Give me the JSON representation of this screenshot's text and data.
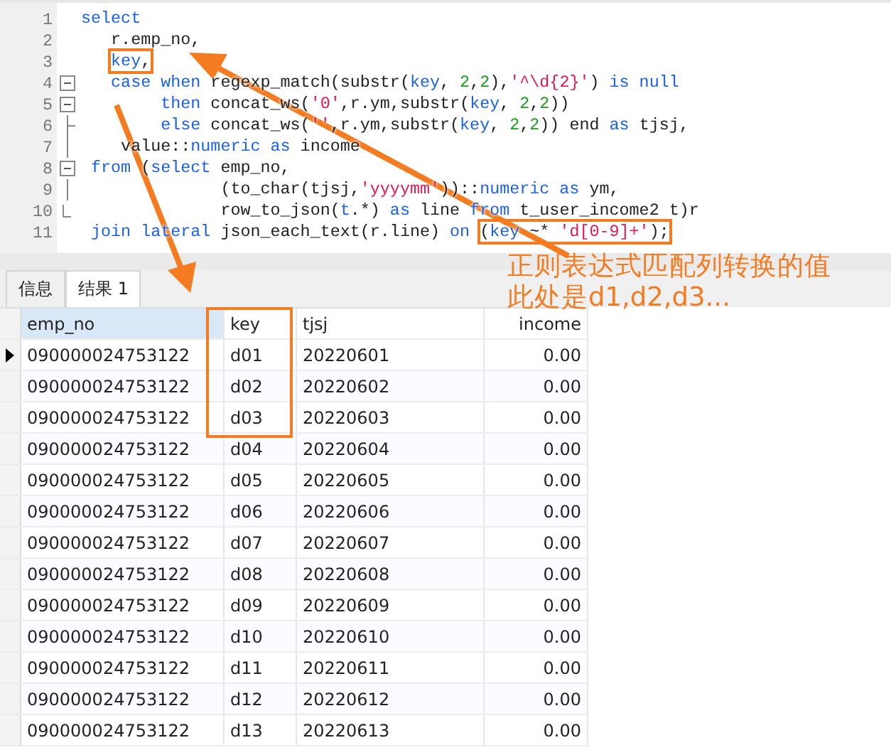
{
  "editor": {
    "lines": [
      {
        "number": "1",
        "kind": "plain",
        "tokens": [
          {
            "kind": "kw",
            "text": "select"
          }
        ]
      },
      {
        "number": "2",
        "kind": "plain",
        "tokens": [
          {
            "kind": "plain",
            "text": "   r.emp_no,"
          }
        ]
      },
      {
        "number": "3",
        "kind": "plain",
        "tokens": [
          {
            "kind": "kw",
            "text": "   key",
            "boxed": true
          },
          {
            "kind": "plain",
            "text": ",",
            "boxed": true
          }
        ]
      },
      {
        "number": "4",
        "kind": "fold-start",
        "tokens": [
          {
            "kind": "kw",
            "text": "   case when"
          },
          {
            "kind": "plain",
            "text": " regexp_match(substr("
          },
          {
            "kind": "kw",
            "text": "key"
          },
          {
            "kind": "plain",
            "text": ", "
          },
          {
            "kind": "num",
            "text": "2"
          },
          {
            "kind": "plain",
            "text": ","
          },
          {
            "kind": "num",
            "text": "2"
          },
          {
            "kind": "plain",
            "text": "),"
          },
          {
            "kind": "str",
            "text": "'^\\d{2}'"
          },
          {
            "kind": "plain",
            "text": ") "
          },
          {
            "kind": "kw",
            "text": "is null"
          }
        ]
      },
      {
        "number": "5",
        "kind": "fold-start",
        "tokens": [
          {
            "kind": "kw",
            "text": "        then"
          },
          {
            "kind": "plain",
            "text": " concat_ws("
          },
          {
            "kind": "str",
            "text": "'0'"
          },
          {
            "kind": "plain",
            "text": ",r.ym,substr("
          },
          {
            "kind": "kw",
            "text": "key"
          },
          {
            "kind": "plain",
            "text": ", "
          },
          {
            "kind": "num",
            "text": "2"
          },
          {
            "kind": "plain",
            "text": ","
          },
          {
            "kind": "num",
            "text": "2"
          },
          {
            "kind": "plain",
            "text": "))"
          }
        ]
      },
      {
        "number": "6",
        "kind": "fold-branch",
        "tokens": [
          {
            "kind": "kw",
            "text": "        else"
          },
          {
            "kind": "plain",
            "text": " concat_ws("
          },
          {
            "kind": "str",
            "text": "''"
          },
          {
            "kind": "plain",
            "text": ",r.ym,substr("
          },
          {
            "kind": "kw",
            "text": "key"
          },
          {
            "kind": "plain",
            "text": ", "
          },
          {
            "kind": "num",
            "text": "2"
          },
          {
            "kind": "plain",
            "text": ","
          },
          {
            "kind": "num",
            "text": "2"
          },
          {
            "kind": "plain",
            "text": ")) end"
          },
          {
            "kind": "kw",
            "text": " as"
          },
          {
            "kind": "plain",
            "text": " tjsj,"
          }
        ]
      },
      {
        "number": "7",
        "kind": "fold-line",
        "tokens": [
          {
            "kind": "plain",
            "text": "    value::"
          },
          {
            "kind": "kw",
            "text": "numeric as"
          },
          {
            "kind": "plain",
            "text": " income"
          }
        ]
      },
      {
        "number": "8",
        "kind": "fold-start",
        "tokens": [
          {
            "kind": "kw",
            "text": " from"
          },
          {
            "kind": "plain",
            "text": " ("
          },
          {
            "kind": "kw",
            "text": "select"
          },
          {
            "kind": "plain",
            "text": " emp_no,"
          }
        ]
      },
      {
        "number": "9",
        "kind": "fold-line",
        "tokens": [
          {
            "kind": "plain",
            "text": "              (to_char(tjsj,"
          },
          {
            "kind": "str",
            "text": "'yyyymm'"
          },
          {
            "kind": "plain",
            "text": "))::"
          },
          {
            "kind": "kw",
            "text": "numeric as"
          },
          {
            "kind": "plain",
            "text": " ym,"
          }
        ]
      },
      {
        "number": "10",
        "kind": "fold-end",
        "tokens": [
          {
            "kind": "plain",
            "text": "              row_to_json("
          },
          {
            "kind": "kw",
            "text": "t"
          },
          {
            "kind": "plain",
            "text": ".*)"
          },
          {
            "kind": "kw",
            "text": " as"
          },
          {
            "kind": "plain",
            "text": " line"
          },
          {
            "kind": "kw",
            "text": " from"
          },
          {
            "kind": "plain",
            "text": " t_user_income2 t)r"
          }
        ]
      },
      {
        "number": "11",
        "kind": "plain",
        "tokens": [
          {
            "kind": "kw",
            "text": " join lateral"
          },
          {
            "kind": "plain",
            "text": " json_each_text(r.line)"
          },
          {
            "kind": "kw",
            "text": " on"
          },
          {
            "kind": "plain",
            "text": " (",
            "boxed": true
          },
          {
            "kind": "kw",
            "text": "key",
            "boxed": true
          },
          {
            "kind": "plain",
            "text": " ~* ",
            "boxed": true
          },
          {
            "kind": "str",
            "text": "'d[0-9]+'",
            "boxed": true
          },
          {
            "kind": "plain",
            "text": ");",
            "boxed": true
          }
        ]
      }
    ]
  },
  "annotation": [
    "正则表达式匹配列转换的值",
    "此处是d1,d2,d3..."
  ],
  "tabs": [
    {
      "label": "信息",
      "selected": false
    },
    {
      "label": "结果 1",
      "selected": true
    }
  ],
  "table": {
    "columns": [
      {
        "label": "emp_no",
        "selected": true
      },
      {
        "label": "key",
        "selected": false
      },
      {
        "label": "tjsj",
        "selected": false
      },
      {
        "label": "income",
        "selected": false
      }
    ],
    "rows": [
      {
        "current": true,
        "cells": [
          "090000024753122",
          "d01",
          "20220601",
          "0.00"
        ]
      },
      {
        "current": false,
        "cells": [
          "090000024753122",
          "d02",
          "20220602",
          "0.00"
        ]
      },
      {
        "current": false,
        "cells": [
          "090000024753122",
          "d03",
          "20220603",
          "0.00"
        ]
      },
      {
        "current": false,
        "cells": [
          "090000024753122",
          "d04",
          "20220604",
          "0.00"
        ]
      },
      {
        "current": false,
        "cells": [
          "090000024753122",
          "d05",
          "20220605",
          "0.00"
        ]
      },
      {
        "current": false,
        "cells": [
          "090000024753122",
          "d06",
          "20220606",
          "0.00"
        ]
      },
      {
        "current": false,
        "cells": [
          "090000024753122",
          "d07",
          "20220607",
          "0.00"
        ]
      },
      {
        "current": false,
        "cells": [
          "090000024753122",
          "d08",
          "20220608",
          "0.00"
        ]
      },
      {
        "current": false,
        "cells": [
          "090000024753122",
          "d09",
          "20220609",
          "0.00"
        ]
      },
      {
        "current": false,
        "cells": [
          "090000024753122",
          "d10",
          "20220610",
          "0.00"
        ]
      },
      {
        "current": false,
        "cells": [
          "090000024753122",
          "d11",
          "20220611",
          "0.00"
        ]
      },
      {
        "current": false,
        "cells": [
          "090000024753122",
          "d12",
          "20220612",
          "0.00"
        ]
      },
      {
        "current": false,
        "cells": [
          "090000024753122",
          "d13",
          "20220613",
          "0.00"
        ]
      }
    ]
  }
}
